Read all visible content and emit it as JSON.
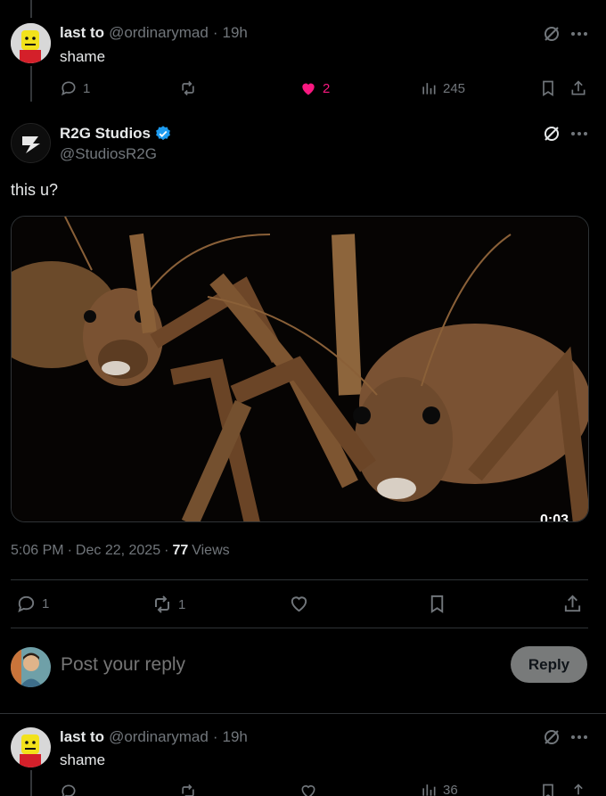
{
  "reply1": {
    "name": "last to",
    "handle": "@ordinarymad",
    "dot": "·",
    "time": "19h",
    "text": "shame",
    "replies": "1",
    "likes": "2",
    "views": "245"
  },
  "main_post": {
    "name": "R2G Studios",
    "handle": "@StudiosR2G",
    "text": "this u?",
    "video_time": "0:03",
    "time": "5:06 PM",
    "dot": "·",
    "date": "Dec 22, 2025",
    "views_count": "77",
    "views_label": "Views",
    "replies": "1",
    "reposts": "1"
  },
  "composer": {
    "placeholder": "Post your reply",
    "reply_button": "Reply"
  },
  "reply2": {
    "name": "last to",
    "handle": "@ordinarymad",
    "dot": "·",
    "time": "19h",
    "text": "shame",
    "views": "36"
  },
  "colors": {
    "like_active": "#f91880",
    "verified": "#1d9bf0",
    "muted": "#71767b"
  }
}
